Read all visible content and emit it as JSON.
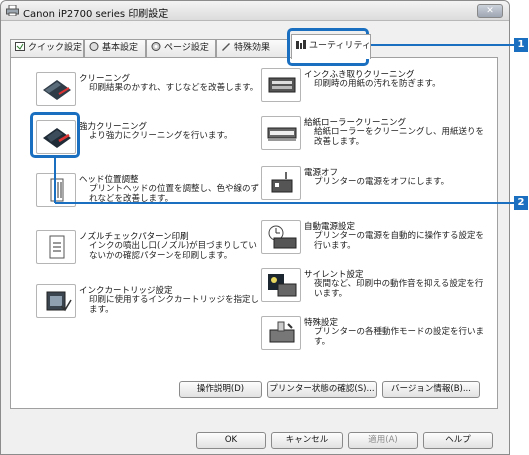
{
  "window": {
    "title": "Canon iP2700 series 印刷設定",
    "close_glyph": "✕"
  },
  "tabs": [
    {
      "label": "クイック設定",
      "icon": "quick-setup-icon"
    },
    {
      "label": "基本設定",
      "icon": "main-icon"
    },
    {
      "label": "ページ設定",
      "icon": "page-setup-icon"
    },
    {
      "label": "特殊効果",
      "icon": "effects-icon"
    },
    {
      "label": "ユーティリティ",
      "icon": "maintenance-icon",
      "active": true
    }
  ],
  "items_left": [
    {
      "title": "クリーニング",
      "desc": "印刷結果のかすれ、すじなどを改善します。"
    },
    {
      "title": "強力クリーニング",
      "desc": "より強力にクリーニングを行います。"
    },
    {
      "title": "ヘッド位置調整",
      "desc": "プリントヘッドの位置を調整し、色や線のずれなどを改善します。"
    },
    {
      "title": "ノズルチェックパターン印刷",
      "desc": "インクの噴出し口(ノズル)が目づまりしていないかの確認パターンを印刷します。"
    },
    {
      "title": "インクカートリッジ設定",
      "desc": "印刷に使用するインクカートリッジを指定します。"
    }
  ],
  "items_right": [
    {
      "title": "インクふき取りクリーニング",
      "desc": "印刷時の用紙の汚れを防ぎます。"
    },
    {
      "title": "給紙ローラークリーニング",
      "desc": "給紙ローラーをクリーニングし、用紙送りを改善します。"
    },
    {
      "title": "電源オフ",
      "desc": "プリンターの電源をオフにします。"
    },
    {
      "title": "自動電源設定",
      "desc": "プリンターの電源を自動的に操作する設定を行います。"
    },
    {
      "title": "サイレント設定",
      "desc": "夜間など、印刷中の動作音を抑える設定を行います。"
    },
    {
      "title": "特殊設定",
      "desc": "プリンターの各種動作モードの設定を行います。"
    }
  ],
  "panel_buttons": {
    "manual": "操作説明(D)",
    "status": "プリンター状態の確認(S)...",
    "version": "バージョン情報(B)..."
  },
  "dialog_buttons": {
    "ok": "OK",
    "cancel": "キャンセル",
    "apply": "適用(A)",
    "help": "ヘルプ"
  },
  "callouts": {
    "c1": "1",
    "c2": "2"
  },
  "colors": {
    "callout": "#1b6fc0",
    "window_bg": "#f0f0f0"
  }
}
